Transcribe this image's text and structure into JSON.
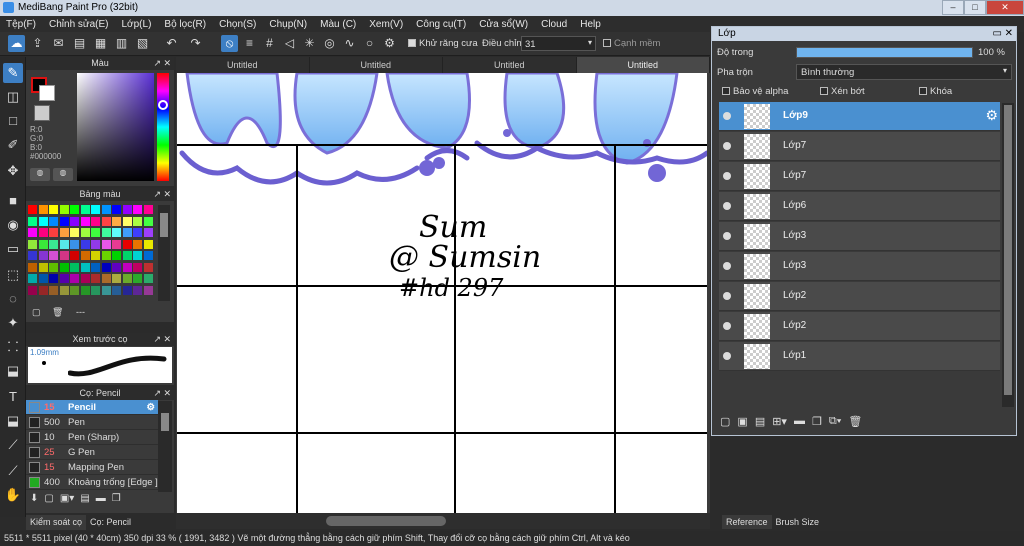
{
  "window": {
    "title": "MediBang Paint Pro (32bit)"
  },
  "menu": [
    "Tệp(F)",
    "Chỉnh sửa(E)",
    "Lớp(L)",
    "Bộ lọc(R)",
    "Chọn(S)",
    "Chụp(N)",
    "Màu (C)",
    "Xem(V)",
    "Công cụ(T)",
    "Cửa sổ(W)",
    "Cloud",
    "Help"
  ],
  "toolbar": {
    "antialias_label": "Khử răng cưa",
    "correction_label": "Điều chỉnh",
    "correction_value": "31",
    "snap_label": "Cạnh mềm"
  },
  "color_panel": {
    "title": "Màu",
    "r": "R:0",
    "g": "G:0",
    "b": "B:0",
    "hex": "#000000"
  },
  "palette_panel": {
    "title": "Bảng màu",
    "footer": "---"
  },
  "brush_preview": {
    "title": "Xem trước cọ",
    "size": "1.09mm"
  },
  "brush_panel": {
    "title": "Cọ: Pencil",
    "items": [
      {
        "size": "15",
        "name": "Pencil",
        "color": "#4a90d0",
        "size_color": "#ff6b6b"
      },
      {
        "size": "500",
        "name": "Pen",
        "color": "#222222",
        "size_color": "#dddddd"
      },
      {
        "size": "10",
        "name": "Pen (Sharp)",
        "color": "#222222",
        "size_color": "#dddddd"
      },
      {
        "size": "25",
        "name": "G Pen",
        "color": "#222222",
        "size_color": "#ff6b6b"
      },
      {
        "size": "15",
        "name": "Mapping Pen",
        "color": "#222222",
        "size_color": "#ff6b6b"
      },
      {
        "size": "400",
        "name": "Khoảng trống [Edge ]",
        "color": "#22aa22",
        "size_color": "#dddddd"
      }
    ]
  },
  "bottom_tabs": [
    "Kiểm soát cọ",
    "Cọ: Pencil"
  ],
  "canvas_tabs": [
    "Untitled",
    "Untitled",
    "Untitled",
    "Untitled"
  ],
  "canvas_text": {
    "line1": "Sum",
    "line2": "@ Sumsin",
    "line3": "#hd 297"
  },
  "status": {
    "text": "5511 * 5511 pixel   (40 * 40cm)   350 dpi   33 %   ( 1991, 3482 )   Vẽ một đường thẳng bằng cách giữ phím Shift, Thay đổi cỡ cọ bằng cách giữ phím Ctrl, Alt và kéo"
  },
  "layers_panel": {
    "title": "Lớp",
    "opacity_label": "Độ trong",
    "opacity_value": "100 %",
    "opacity": 1.0,
    "blend_label": "Pha trộn",
    "blend_value": "Bình thường",
    "protect_alpha": "Bảo vệ alpha",
    "clipping": "Xén bớt",
    "lock": "Khóa",
    "layers": [
      "Lớp9",
      "Lớp7",
      "Lớp7",
      "Lớp6",
      "Lớp3",
      "Lớp3",
      "Lớp2",
      "Lớp2",
      "Lớp1"
    ]
  },
  "right_tabs": [
    "Reference",
    "Brush Size"
  ],
  "colors": {
    "accent": "#3d7fc4",
    "selected": "#4a90d0"
  }
}
